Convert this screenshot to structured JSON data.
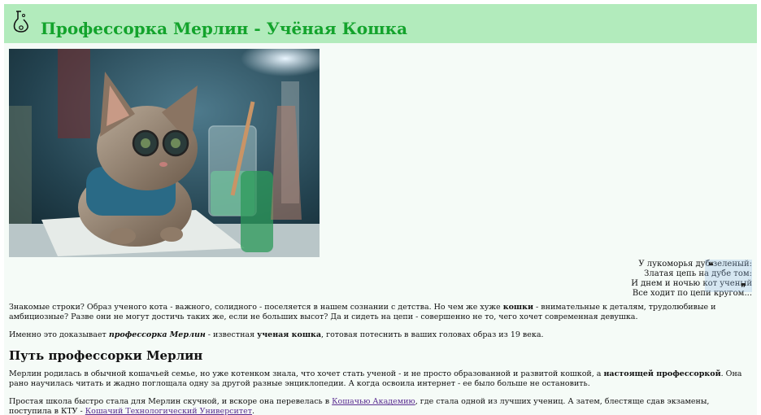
{
  "header": {
    "title": "Профессорка Мерлин - Учёная Кошка",
    "logo_icon": "flask-icon"
  },
  "hero": {
    "image": "kitten-scientist-illustration"
  },
  "poem": {
    "lines": [
      "У лукоморья дуб зеленый:",
      "Златая цепь на дубе том:",
      "И днем и ночью кот ученый",
      "Все ходит по цепи кругом..."
    ]
  },
  "intro": {
    "p1_a": "Знакомые строки? Образ ученого кота - важного, солидного - поселяется в нашем сознании с детства. Но чем же хуже ",
    "p1_bold": "кошки",
    "p1_b": " - внимательные к деталям, трудолюбивые и амбициозные? Разве они не могут достичь таких же, если не больших высот? Да и сидеть на цепи - совершенно не то, чего хочет современная девушка.",
    "p2_a": "Именно это доказывает ",
    "p2_bi": "профессорка Мерлин",
    "p2_b": " - известная ",
    "p2_bold": "ученая кошка",
    "p2_c": ", готовая потеснить в ваших головах образ из 19 века."
  },
  "section": {
    "heading": "Путь профессорки Мерлин",
    "p3_a": "Мерлин родилась в обычной кошачьей семье, но уже котенком знала, что хочет стать ученой - и не просто образованной и развитой кошкой, а ",
    "p3_bold": "настоящей профессоркой",
    "p3_b": ". Она рано научилась читать и жадно поглощала одну за другой разные энциклопедии. А когда освоила интернет - ее было больше не остановить.",
    "p4_a": "Простая школа быстро стала для Мерлин скучной, и вскоре она перевелась в ",
    "p4_link1": "Кошачью Академию",
    "p4_b": ", где стала одной из лучших учениц. А затем, блестяще сдав экзамены, поступила в КТУ - ",
    "p4_link2": "Кошачий Технологический Университет",
    "p4_c": "."
  }
}
